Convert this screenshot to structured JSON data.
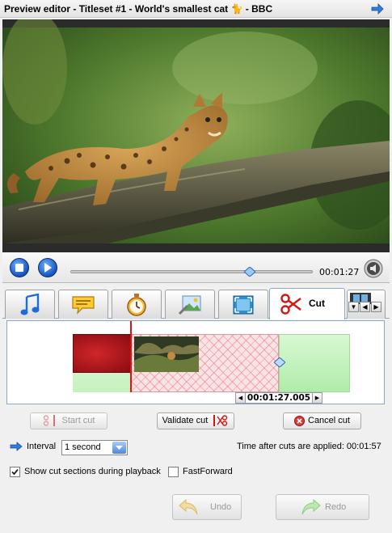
{
  "window": {
    "title_part1": "Preview editor - Titleset #1 - World's smallest cat ",
    "title_glyph": "🐈",
    "title_part2": " - BBC"
  },
  "player": {
    "time": "00:01:27",
    "position_fraction": 0.74
  },
  "tabs": [
    {
      "icon": "music-note-icon"
    },
    {
      "icon": "subtitle-icon"
    },
    {
      "icon": "stopwatch-icon"
    },
    {
      "icon": "image-edit-icon"
    },
    {
      "icon": "crop-icon"
    },
    {
      "icon": "scissors-icon",
      "label": "Cut",
      "active": true
    },
    {
      "icon": "film-strip-icon"
    }
  ],
  "timeline": {
    "time": "00:01:27.005"
  },
  "actions": {
    "start_cut": "Start cut",
    "validate_cut": "Validate cut",
    "cancel_cut": "Cancel cut"
  },
  "interval": {
    "label": "Interval",
    "value": "1 second"
  },
  "time_after_cuts": "Time after cuts are applied: 00:01:57",
  "options": {
    "show_cut_sections": {
      "label": "Show cut sections during playback",
      "checked": true
    },
    "fast_forward": {
      "label": "FastForward",
      "checked": false
    }
  },
  "history": {
    "undo": "Undo",
    "redo": "Redo"
  },
  "colors": {
    "accent": "#1554c0",
    "cut_marker": "#d11616",
    "cut_region": "#fbe3e5",
    "kept_region": "#c7f1bf"
  }
}
